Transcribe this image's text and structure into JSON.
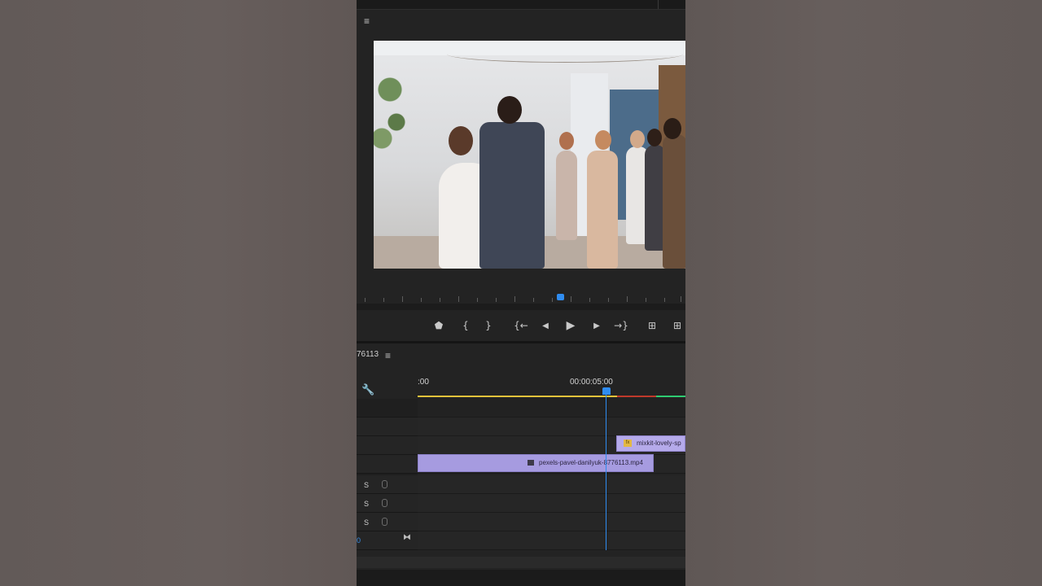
{
  "program_monitor": {
    "menu_glyph": "≡",
    "playback_controls": [
      {
        "name": "add-marker-button",
        "glyph": "⬟"
      },
      {
        "name": "mark-in-button",
        "glyph": "{"
      },
      {
        "name": "mark-out-button",
        "glyph": "}"
      },
      {
        "name": "go-to-in-button",
        "glyph": "{←"
      },
      {
        "name": "step-back-button",
        "glyph": "◀"
      },
      {
        "name": "play-button",
        "glyph": "▶"
      },
      {
        "name": "step-forward-button",
        "glyph": "▶"
      },
      {
        "name": "go-to-out-button",
        "glyph": "→}"
      },
      {
        "name": "lift-button",
        "glyph": "⊞"
      },
      {
        "name": "extract-button",
        "glyph": "⊞"
      }
    ]
  },
  "timeline": {
    "sequence_name": "76113",
    "menu_glyph": "≡",
    "timecode_start": ":00",
    "timecode_mid": "00:00:05:00",
    "video_clip": "pexels-pavel-danilyuk-8776113.mp4",
    "audio_clip": "mixkit-lovely-sp",
    "audio_tracks": [
      {
        "solo": "S"
      },
      {
        "solo": "S"
      },
      {
        "solo": "S"
      }
    ],
    "mix_value": "0",
    "colors": {
      "playhead": "#2f8cf0",
      "clip": "#a69be0",
      "work_area": "#e6c23a",
      "render_red": "#c0392b",
      "render_green": "#2ecc71"
    }
  }
}
